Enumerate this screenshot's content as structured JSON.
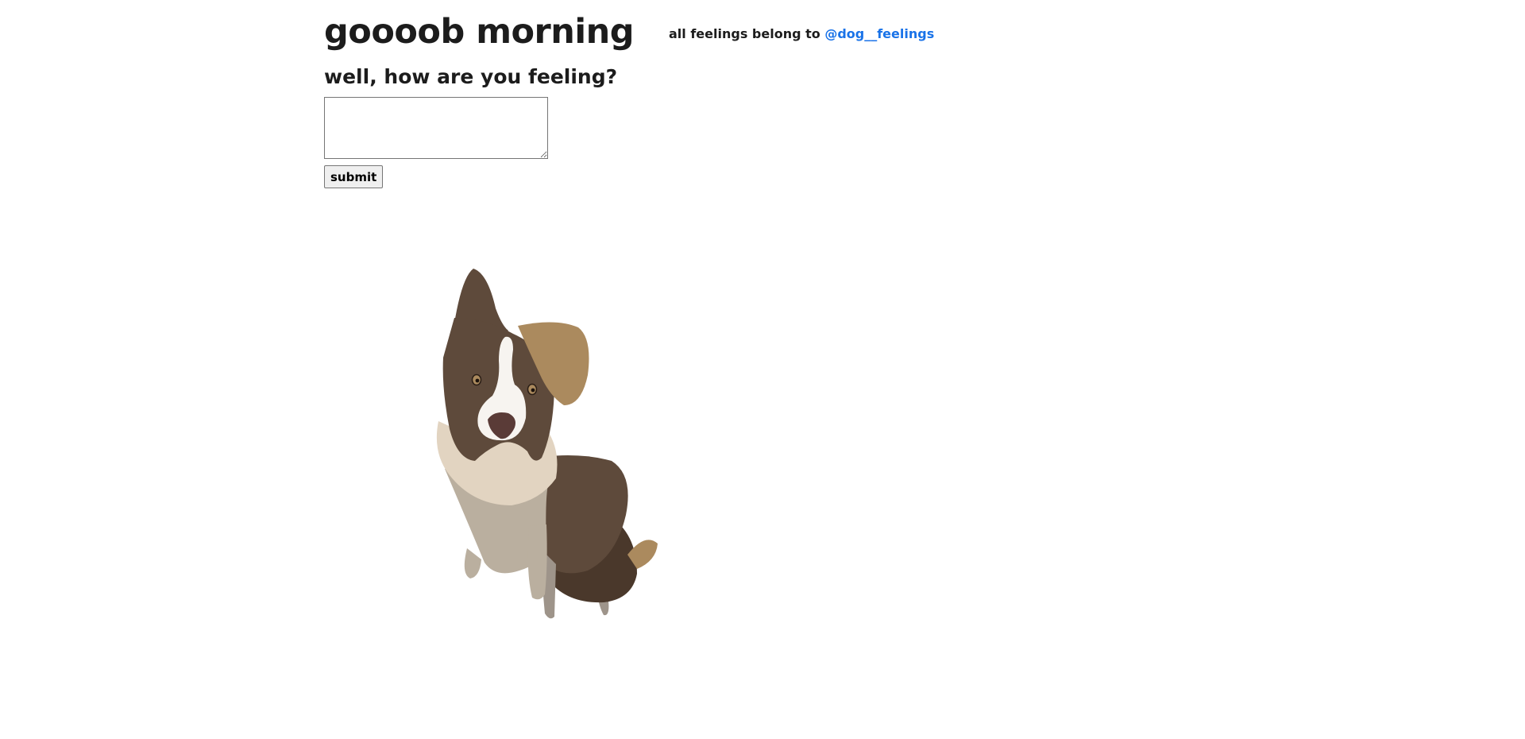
{
  "header": {
    "title": "goooob morning",
    "credit_prefix": "all feelings belong to ",
    "credit_link": "@dog__feelings"
  },
  "form": {
    "question": "well, how are you feeling?",
    "input_value": "",
    "submit_label": "submit"
  },
  "illustration": {
    "subject": "dog",
    "colors": {
      "dark_brown": "#5e4a3b",
      "darker_brown": "#4a382b",
      "tan_ear": "#ab8a5e",
      "cream": "#e2d4c1",
      "grey_beige": "#baaf9f",
      "leg_grey": "#9e948a",
      "white": "#f7f4f0",
      "nose": "#5a3b37"
    }
  },
  "colors": {
    "text": "#1c1c1c",
    "link": "#1a73e8",
    "background": "#ffffff"
  }
}
